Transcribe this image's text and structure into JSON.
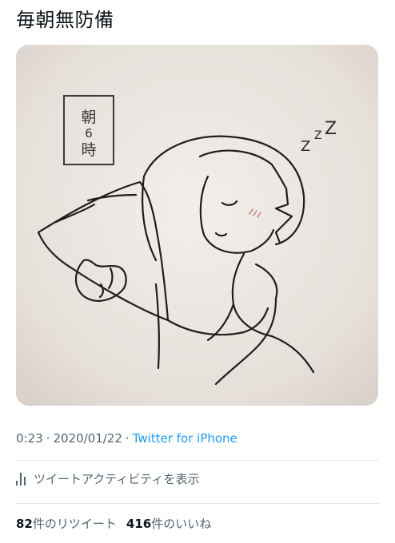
{
  "tweet": {
    "text": "毎朝無防備",
    "image_alt": "朝6時",
    "time": "0:23",
    "date": "2020/01/22",
    "source": "Twitter for iPhone",
    "activity_label": "ツイートアクティビティを表示",
    "retweets_count": "82",
    "retweets_label": "件のリツイート",
    "likes_count": "416",
    "likes_label": "件のいいね"
  },
  "drawing": {
    "sign_text": [
      "朝",
      "6",
      "時"
    ],
    "sleep_marks": [
      "Z",
      "Z",
      "Z"
    ]
  }
}
